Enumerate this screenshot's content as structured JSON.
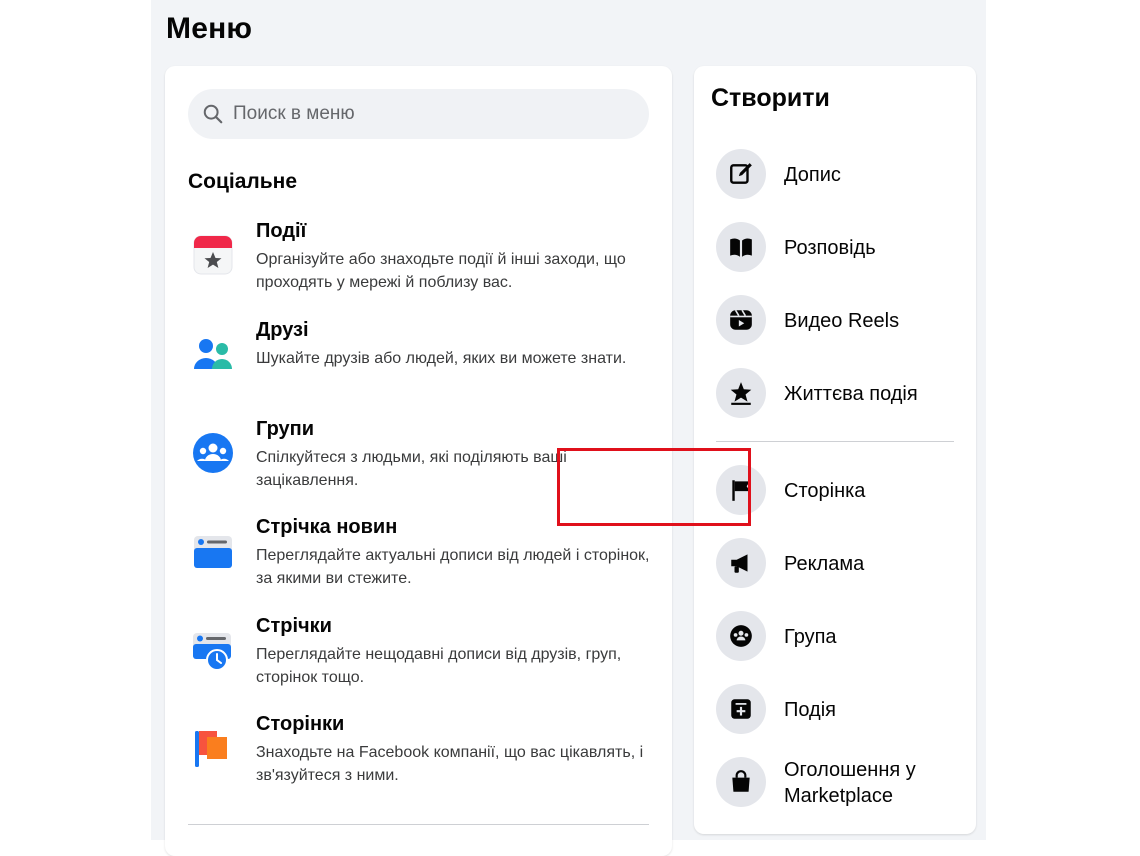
{
  "menu": {
    "title": "Меню",
    "search_placeholder": "Поиск в меню",
    "social_title": "Соціальне",
    "items": [
      {
        "name": "Події",
        "desc": "Організуйте або знаходьте події й інші заходи, що проходять у мережі й поблизу вас.",
        "icon": "calendar-icon"
      },
      {
        "name": "Друзі",
        "desc": "Шукайте друзів або людей, яких ви можете знати.",
        "icon": "friends-icon"
      },
      {
        "name": "Групи",
        "desc": "Спілкуйтеся з людьми, які поділяють ваші зацікавлення.",
        "icon": "groups-icon"
      },
      {
        "name": "Стрічка новин",
        "desc": "Переглядайте актуальні дописи від людей і сторінок, за якими ви стежите.",
        "icon": "feed-icon"
      },
      {
        "name": "Стрічки",
        "desc": "Переглядайте нещодавні дописи від друзів, груп, сторінок тощо.",
        "icon": "feeds-clock-icon"
      },
      {
        "name": "Сторінки",
        "desc": "Знаходьте на Facebook компанії, що вас цікавлять, і зв'язуйтеся з ними.",
        "icon": "pages-flag-icon"
      }
    ]
  },
  "create": {
    "title": "Створити",
    "items": [
      {
        "label": "Допис",
        "icon": "edit-post-icon"
      },
      {
        "label": "Розповідь",
        "icon": "story-book-icon"
      },
      {
        "label": "Видео Reels",
        "icon": "reels-icon"
      },
      {
        "label": "Життєва подія",
        "icon": "life-event-star-icon"
      },
      {
        "label": "Сторінка",
        "icon": "page-flag-icon"
      },
      {
        "label": "Реклама",
        "icon": "megaphone-icon"
      },
      {
        "label": "Група",
        "icon": "group-icon"
      },
      {
        "label": "Подія",
        "icon": "event-icon"
      },
      {
        "label": "Оголошення у Marketplace",
        "icon": "marketplace-bag-icon"
      }
    ]
  },
  "colors": {
    "accent": "#1877f2",
    "highlight": "#e0101b",
    "panel": "#f2f4f7"
  }
}
